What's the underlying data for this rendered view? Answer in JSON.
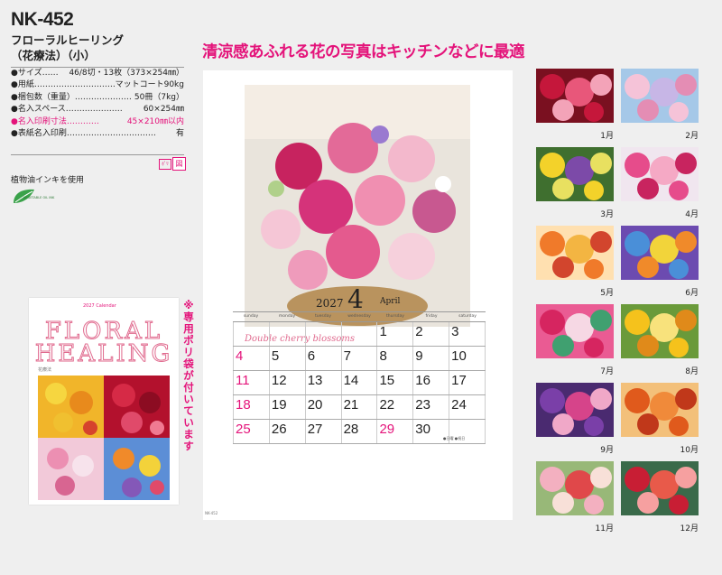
{
  "product": {
    "model": "NK-452",
    "name_line1": "フローラルヒーリング",
    "name_line2": "（花療法）（小）",
    "specs": [
      {
        "label": "●サイズ……",
        "value": "46/8切・13枚（373×254㎜）",
        "highlight": false
      },
      {
        "label": "●用紙…………………………",
        "value": "マットコート90kg",
        "highlight": false
      },
      {
        "label": "●梱包数（重量）…………………",
        "value": "50冊（7kg）",
        "highlight": false
      },
      {
        "label": "●名入スペース…………………",
        "value": "60×254㎜",
        "highlight": false
      },
      {
        "label": "●名入印刷寸法…………",
        "value": "45×210㎜以内",
        "highlight": true
      },
      {
        "label": "●表紙名入印刷……………………………",
        "value": "有",
        "highlight": false
      }
    ],
    "badge_small": "ﾎﾟﾘ",
    "badge_box": "図",
    "ink_note": "植物油インキを使用",
    "veg_ink_label": "VEGETABLE OIL INK"
  },
  "cover": {
    "title_line1": "FLORAL",
    "title_line2": "HEALING",
    "small_text": "2027 Calendar",
    "subtitle_text": "花療法"
  },
  "side_note": "※専用ポリ袋が付いています",
  "headline": "清涼感あふれる花の写真はキッチンなどに最適",
  "calendar": {
    "year": "2027",
    "month_number": "4",
    "month_name": "April",
    "caption": "Double cherry blossoms",
    "weekdays": [
      "sunday",
      "monday",
      "tuesday",
      "wednesday",
      "thursday",
      "friday",
      "saturday"
    ],
    "weeks": [
      [
        "",
        "",
        "",
        "",
        "1",
        "2",
        "3"
      ],
      [
        "4",
        "5",
        "6",
        "7",
        "8",
        "9",
        "10"
      ],
      [
        "11",
        "12",
        "13",
        "14",
        "15",
        "16",
        "17"
      ],
      [
        "18",
        "19",
        "20",
        "21",
        "22",
        "23",
        "24"
      ],
      [
        "25",
        "26",
        "27",
        "28",
        "29",
        "30",
        ""
      ]
    ],
    "holidays": [
      "29"
    ],
    "legend": "●日曜 ●祝日",
    "footer": "NK-452"
  },
  "thumbnails": [
    {
      "label": "1月",
      "colors": [
        "#c5173b",
        "#e8577a",
        "#f3a3b8",
        "#7a1020"
      ]
    },
    {
      "label": "2月",
      "colors": [
        "#f5c3d8",
        "#c7b6e6",
        "#e48db4",
        "#a5c8e8"
      ]
    },
    {
      "label": "3月",
      "colors": [
        "#f3d22a",
        "#7c4aa8",
        "#e8e060",
        "#3f6f2f"
      ]
    },
    {
      "label": "4月",
      "colors": [
        "#e64c8b",
        "#f5a9c5",
        "#c8245f",
        "#f0e6ef"
      ]
    },
    {
      "label": "5月",
      "colors": [
        "#f07a2a",
        "#f3b542",
        "#d2452d",
        "#ffe0b0"
      ]
    },
    {
      "label": "6月",
      "colors": [
        "#4a8fd8",
        "#f2d43a",
        "#f08a2a",
        "#6c4bb0"
      ]
    },
    {
      "label": "7月",
      "colors": [
        "#d62560",
        "#f6d8e4",
        "#40a070",
        "#ea5b93"
      ]
    },
    {
      "label": "8月",
      "colors": [
        "#f5c21c",
        "#f8e27c",
        "#e08a1a",
        "#6a9a3a"
      ]
    },
    {
      "label": "9月",
      "colors": [
        "#7a3fa8",
        "#d6448a",
        "#f0a8c8",
        "#4a2a70"
      ]
    },
    {
      "label": "10月",
      "colors": [
        "#e05a1c",
        "#f08a3a",
        "#c0381a",
        "#f3c07a"
      ]
    },
    {
      "label": "11月",
      "colors": [
        "#f3b0c0",
        "#e0484a",
        "#f8e0d8",
        "#98b878"
      ]
    },
    {
      "label": "12月",
      "colors": [
        "#c81e34",
        "#e85a4a",
        "#f6a0a0",
        "#3a6a4a"
      ]
    }
  ]
}
